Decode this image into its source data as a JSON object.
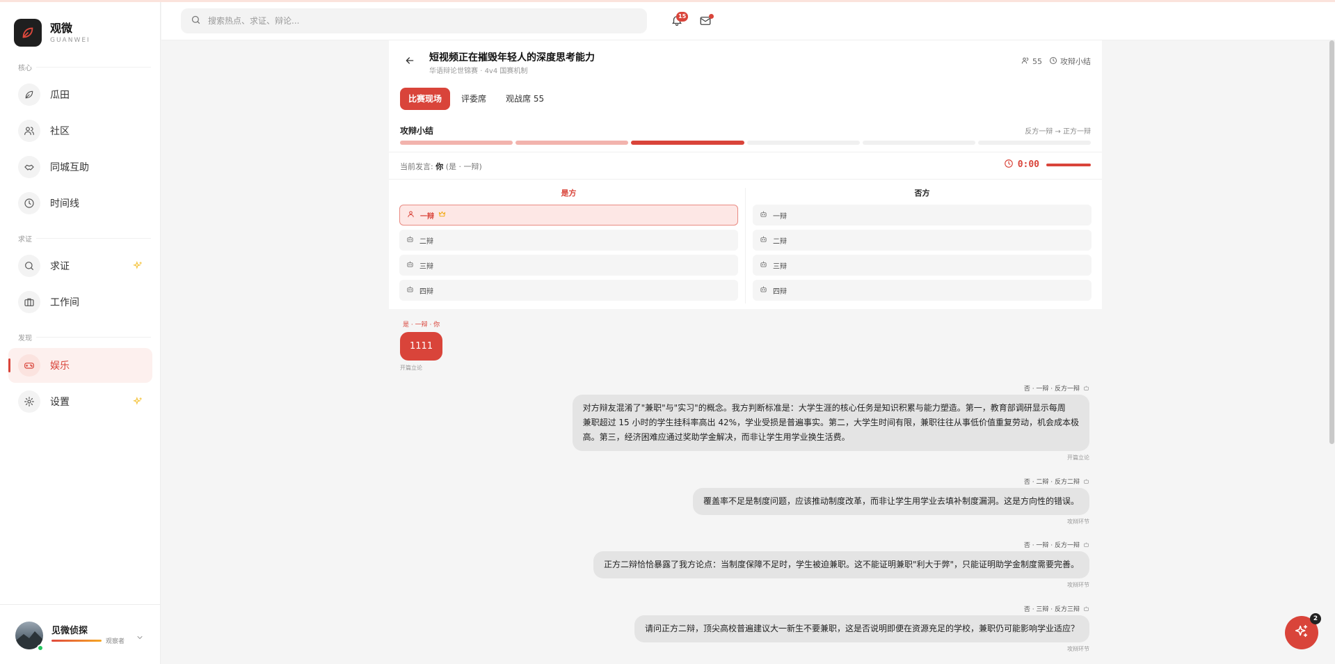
{
  "app": {
    "name": "观微",
    "name_sub": "GUANWEI"
  },
  "sidebar": {
    "sections": {
      "core": "核心",
      "verify": "求证",
      "discover": "发现"
    },
    "items": [
      {
        "label": "瓜田",
        "icon": "leaf-icon"
      },
      {
        "label": "社区",
        "icon": "users-icon"
      },
      {
        "label": "同城互助",
        "icon": "handshake-icon"
      },
      {
        "label": "时间线",
        "icon": "clock-icon"
      },
      {
        "label": "求证",
        "icon": "search-icon"
      },
      {
        "label": "工作间",
        "icon": "briefcase-icon"
      },
      {
        "label": "娱乐",
        "icon": "gamepad-icon",
        "active": true
      },
      {
        "label": "设置",
        "icon": "gear-icon"
      }
    ],
    "user": {
      "name": "见微侦探",
      "level": "观察者"
    }
  },
  "topbar": {
    "search_placeholder": "搜索热点、求证、辩论...",
    "notification_count": "15"
  },
  "debate": {
    "title": "短视频正在摧毁年轻人的深度思考能力",
    "competition": "华语辩论世锦赛",
    "format": "4v4 国赛机制",
    "separator": "·",
    "audience_count": "55",
    "stage_name": "攻辩小结",
    "tabs": [
      "比赛现场",
      "评委席",
      "观战席 55"
    ],
    "stage_title": "攻辩小结",
    "stage_flow": "反方一辩 → 正方一辩",
    "progress": {
      "done": 2,
      "current": 1,
      "total": 6
    },
    "speaker_label": "当前发言:",
    "speaker_name": "你",
    "speaker_role": "(是 · 一辩)",
    "timer": "0:00",
    "pro_side": "是方",
    "con_side": "否方",
    "pro_seats": [
      "一辩",
      "二辩",
      "三辩",
      "四辩"
    ],
    "con_seats": [
      "一辩",
      "二辩",
      "三辩",
      "四辩"
    ]
  },
  "messages": {
    "mine": {
      "meta": "是 · 一辩 · 你",
      "text": "1111",
      "stage": "开篇立论"
    },
    "others": [
      {
        "meta": "否 · 一辩 · 反方一辩",
        "lines": [
          "对方辩友混淆了\"兼职\"与\"实习\"的概念。我方判断标准是：大学生涯的核心任务是知识积累与能力塑造。第一，教育部调研显示每周",
          "兼职超过 15 小时的学生挂科率高出 42%，学业受损是普遍事实。第二，大学生时间有限，兼职往往从事低价值重复劳动，机会成本极",
          "高。第三，经济困难应通过奖助学金解决，而非让学生用学业换生活费。"
        ],
        "stage": "开篇立论"
      },
      {
        "meta": "否 · 二辩 · 反方二辩",
        "lines": [
          "覆盖率不足是制度问题，应该推动制度改革，而非让学生用学业去填补制度漏洞。这是方向性的错误。"
        ],
        "stage": "攻辩环节"
      },
      {
        "meta": "否 · 一辩 · 反方一辩",
        "lines": [
          "正方二辩恰恰暴露了我方论点：当制度保障不足时，学生被迫兼职。这不能证明兼职\"利大于弊\"，只能证明助学金制度需要完善。"
        ],
        "stage": "攻辩环节"
      },
      {
        "meta": "否 · 三辩 · 反方三辩",
        "lines": [
          "请问正方二辩，顶尖高校普遍建议大一新生不要兼职，这是否说明即便在资源充足的学校，兼职仍可能影响学业适应？"
        ],
        "stage": "攻辩环节"
      }
    ]
  },
  "fab": {
    "badge": "2"
  },
  "colors": {
    "accent": "#d9443a",
    "accent_soft": "#fde7e5",
    "bubble": "#e4e4e4"
  }
}
